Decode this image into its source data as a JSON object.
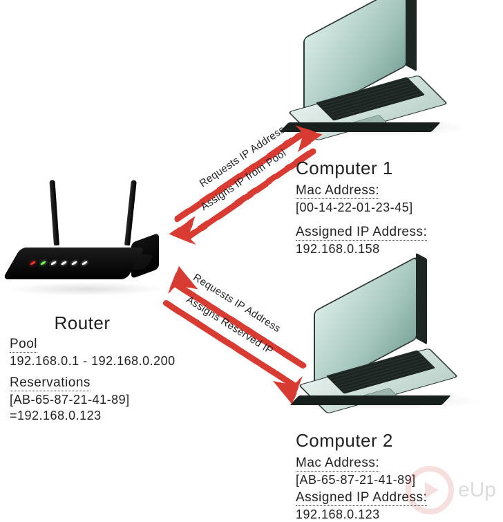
{
  "router": {
    "title": "Router",
    "pool_label": "Pool",
    "pool_range": "192.168.0.1 - 192.168.0.200",
    "reservations_label": "Reservations",
    "reservation_mac": "[AB-65-87-21-41-89]",
    "reservation_ip": "=192.168.0.123"
  },
  "computer1": {
    "title": "Computer 1",
    "mac_label": "Mac Address:",
    "mac_value": "[00-14-22-01-23-45]",
    "ip_label": "Assigned IP Address:",
    "ip_value": "192.168.0.158"
  },
  "computer2": {
    "title": "Computer 2",
    "mac_label": "Mac Address:",
    "mac_value": "[AB-65-87-21-41-89]",
    "ip_label": "Assigned IP Address:",
    "ip_value": "192.168.0.123"
  },
  "arrows": {
    "a1_request": "Requests IP Address",
    "a1_assign": "Assigns IP from Pool",
    "a2_request": "Requests IP Address",
    "a2_assign": "Assigns Reserved IP"
  },
  "watermark": "eUp",
  "colors": {
    "arrow": "#d83a33"
  }
}
